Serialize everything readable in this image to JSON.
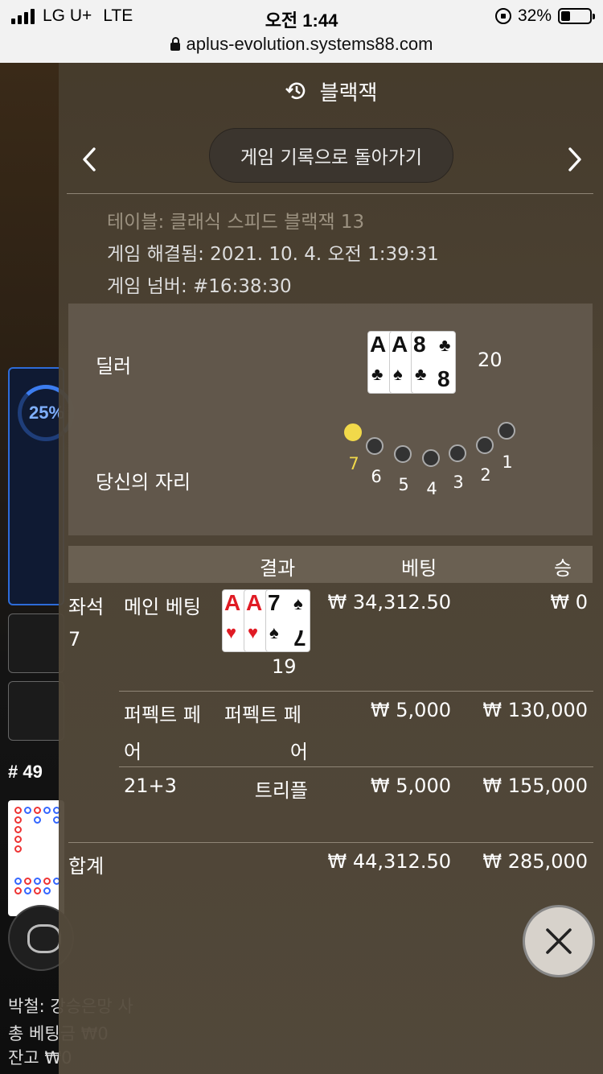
{
  "status_bar": {
    "carrier": "LG U+",
    "network": "LTE",
    "time": "오전 1:44",
    "battery": "32%",
    "battery_level": 0.32
  },
  "browser": {
    "url": "aplus-evolution.systems88.com"
  },
  "background": {
    "percent": "25%",
    "round_number": "# 49",
    "lines": [
      "박철: 강승은망 사",
      "총 베팅금 ₩0",
      "잔고 ₩0"
    ]
  },
  "header": {
    "title": "블랙잭",
    "icon": "history-icon"
  },
  "nav": {
    "back_label": "게임 기록으로 돌아가기",
    "prev_icon": "chevron-left-icon",
    "next_icon": "chevron-right-icon"
  },
  "info": {
    "table": "테이블: 클래식 스피드 블랙잭 13",
    "resolved": "게임 해결됨: 2021. 10. 4. 오전 1:39:31",
    "game_number": "게임 넘버: #16:38:30"
  },
  "dealer": {
    "label": "딜러",
    "cards": [
      {
        "rank": "A",
        "suit": "♣",
        "color": "black"
      },
      {
        "rank": "A",
        "suit": "♠",
        "color": "black"
      },
      {
        "rank": "8",
        "suit": "♣",
        "color": "black"
      }
    ],
    "total": "20"
  },
  "seat": {
    "label": "당신의 자리",
    "seats": [
      "7",
      "6",
      "5",
      "4",
      "3",
      "2",
      "1"
    ],
    "selected": "7",
    "selected_color": "#f1d94a"
  },
  "table_header": {
    "result": "결과",
    "bet": "베팅",
    "win": "승"
  },
  "rows": {
    "main": {
      "seat_label": "좌석",
      "seat_number": "7",
      "name": "메인 베팅",
      "cards": [
        {
          "rank": "A",
          "suit": "♥",
          "color": "red"
        },
        {
          "rank": "A",
          "suit": "♥",
          "color": "red"
        },
        {
          "rank": "7",
          "suit": "♠",
          "color": "black"
        }
      ],
      "total": "19",
      "bet": "₩ 34,312.50",
      "win": "₩ 0"
    },
    "perfect": {
      "name_line1": "퍼펙트 페",
      "name_line2": "어",
      "result_line1": "퍼펙트 페",
      "result_line2": "어",
      "bet": "₩ 5,000",
      "win": "₩ 130,000"
    },
    "side": {
      "name": "21+3",
      "result": "트리플",
      "bet": "₩ 5,000",
      "win": "₩ 155,000"
    }
  },
  "summary": {
    "label": "합계",
    "bet": "₩ 44,312.50",
    "win": "₩ 285,000"
  },
  "close": {
    "icon": "close-icon"
  }
}
